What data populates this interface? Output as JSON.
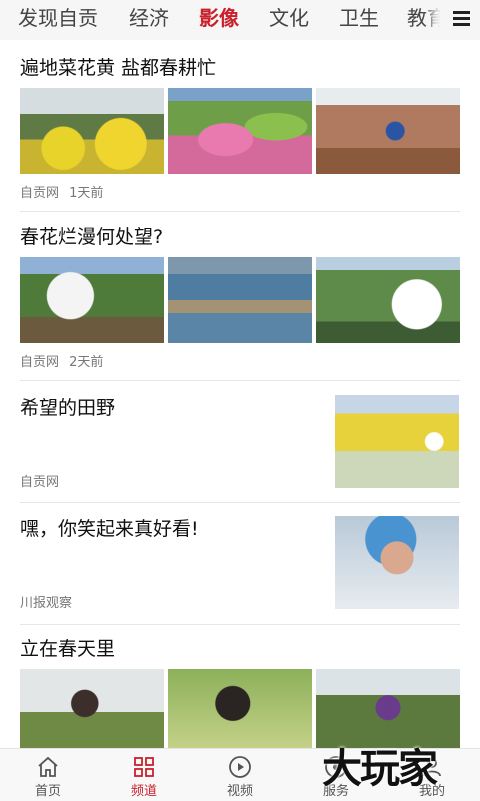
{
  "tabs": [
    "发现自贡",
    "经济",
    "影像",
    "文化",
    "卫生",
    "教育"
  ],
  "active_tab": "影像",
  "feed": [
    {
      "title": "遍地菜花黄 盐都春耕忙",
      "source": "自贡网",
      "time": "1天前"
    },
    {
      "title": "春花烂漫何处望?",
      "source": "自贡网",
      "time": "2天前"
    },
    {
      "title": "希望的田野",
      "source": "自贡网",
      "time": ""
    },
    {
      "title": "嘿，你笑起来真好看!",
      "source": "川报观察",
      "time": ""
    },
    {
      "title": "立在春天里",
      "source": "",
      "time": ""
    }
  ],
  "bottom_nav": [
    {
      "label": "首页",
      "icon": "home-icon"
    },
    {
      "label": "频道",
      "icon": "grid-icon"
    },
    {
      "label": "视频",
      "icon": "play-icon"
    },
    {
      "label": "服务",
      "icon": "services-icon"
    },
    {
      "label": "我的",
      "icon": "profile-icon"
    }
  ],
  "active_nav": "频道",
  "watermark": "大玩家",
  "colors": {
    "accent": "#c9202b",
    "tab_bar": "#f6f6f6",
    "divider": "#e6e6e6"
  }
}
